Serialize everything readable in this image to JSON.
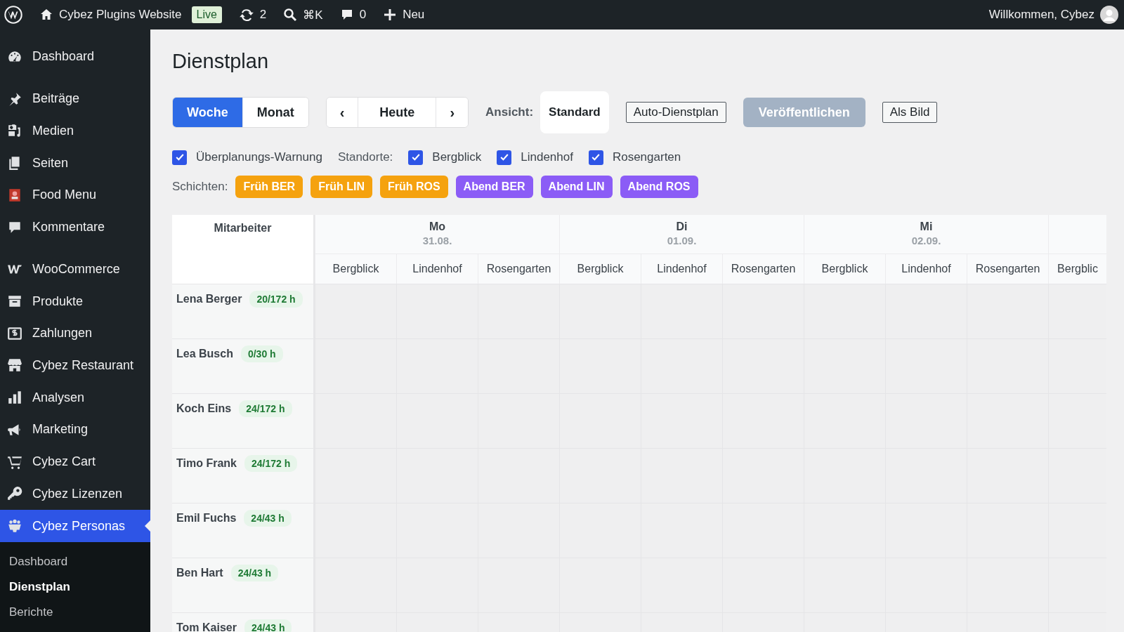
{
  "admin_bar": {
    "site_name": "Cybez Plugins Website",
    "live_badge": "Live",
    "updates": "2",
    "search_shortcut": "⌘K",
    "comments": "0",
    "new_label": "Neu",
    "greeting": "Willkommen, Cybez"
  },
  "sidebar": {
    "items": [
      {
        "label": "Dashboard",
        "selected": false,
        "gap_after": true
      },
      {
        "label": "Beiträge",
        "selected": false
      },
      {
        "label": "Medien",
        "selected": false
      },
      {
        "label": "Seiten",
        "selected": false
      },
      {
        "label": "Food Menu",
        "selected": false
      },
      {
        "label": "Kommentare",
        "selected": false,
        "gap_after": true
      },
      {
        "label": "WooCommerce",
        "selected": false
      },
      {
        "label": "Produkte",
        "selected": false
      },
      {
        "label": "Zahlungen",
        "selected": false
      },
      {
        "label": "Cybez Restaurant",
        "selected": false
      },
      {
        "label": "Analysen",
        "selected": false
      },
      {
        "label": "Marketing",
        "selected": false
      },
      {
        "label": "Cybez Cart",
        "selected": false
      },
      {
        "label": "Cybez Lizenzen",
        "selected": false
      },
      {
        "label": "Cybez Personas",
        "selected": true
      }
    ],
    "submenu": [
      {
        "label": "Dashboard",
        "selected": false
      },
      {
        "label": "Dienstplan",
        "selected": true
      },
      {
        "label": "Berichte",
        "selected": false
      }
    ]
  },
  "page_title": "Dienstplan",
  "toolbar": {
    "range_tabs": [
      {
        "label": "Woche",
        "selected": true
      },
      {
        "label": "Monat",
        "selected": false
      }
    ],
    "prev": "‹",
    "today": "Heute",
    "next": "›",
    "view_label": "Ansicht:",
    "view_value": "Standard",
    "auto_button": "Auto-Dienstplan",
    "publish_button": {
      "label": "Veröffentlichen",
      "disabled": true
    },
    "image_button": "Als Bild"
  },
  "options": {
    "overplan_warning": {
      "label": "Überplanungs-Warnung",
      "checked": true
    },
    "locations_label": "Standorte:",
    "locations": [
      {
        "label": "Bergblick",
        "checked": true
      },
      {
        "label": "Lindenhof",
        "checked": true
      },
      {
        "label": "Rosengarten",
        "checked": true
      }
    ]
  },
  "shifts": {
    "label": "Schichten:",
    "items": [
      {
        "label": "Früh BER",
        "color": "#f5a20f"
      },
      {
        "label": "Früh LIN",
        "color": "#f5a20f"
      },
      {
        "label": "Früh ROS",
        "color": "#f5a20f"
      },
      {
        "label": "Abend BER",
        "color": "#8b5cf6"
      },
      {
        "label": "Abend LIN",
        "color": "#8b5cf6"
      },
      {
        "label": "Abend ROS",
        "color": "#8b5cf6"
      }
    ]
  },
  "schedule": {
    "employee_header": "Mitarbeiter",
    "days": [
      {
        "name": "Mo",
        "date": "31.08.",
        "locations": [
          "Bergblick",
          "Lindenhof",
          "Rosengarten"
        ]
      },
      {
        "name": "Di",
        "date": "01.09.",
        "locations": [
          "Bergblick",
          "Lindenhof",
          "Rosengarten"
        ]
      },
      {
        "name": "Mi",
        "date": "02.09.",
        "locations": [
          "Bergblick",
          "Lindenhof",
          "Rosengarten"
        ]
      },
      {
        "locations": [
          "Bergblic"
        ]
      }
    ],
    "employees": [
      {
        "name": "Lena Berger",
        "hours": "20/172 h"
      },
      {
        "name": "Lea Busch",
        "hours": "0/30 h"
      },
      {
        "name": "Koch Eins",
        "hours": "24/172 h"
      },
      {
        "name": "Timo Frank",
        "hours": "24/172 h"
      },
      {
        "name": "Emil Fuchs",
        "hours": "24/43 h"
      },
      {
        "name": "Ben Hart",
        "hours": "24/43 h"
      },
      {
        "name": "Tom Kaiser",
        "hours": "24/43 h"
      }
    ]
  }
}
